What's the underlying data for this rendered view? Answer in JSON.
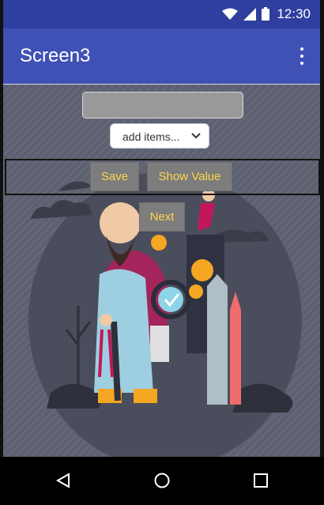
{
  "status_bar": {
    "time": "12:30"
  },
  "app_bar": {
    "title": "Screen3"
  },
  "form": {
    "text_box_value": "",
    "spinner_selected": "add items...",
    "save_label": "Save",
    "show_value_label": "Show Value",
    "next_label": "Next"
  },
  "colors": {
    "app_bar": "#3f51b5",
    "status_bar": "#2f3f9f",
    "button_bg": "#7d7d7d",
    "button_text": "#ffd54a",
    "background": "#5d6070"
  },
  "icons": {
    "status": [
      "wifi-icon",
      "signal-icon",
      "battery-icon"
    ],
    "nav": [
      "back-icon",
      "home-icon",
      "recents-icon"
    ],
    "menu": "overflow-menu-icon"
  }
}
